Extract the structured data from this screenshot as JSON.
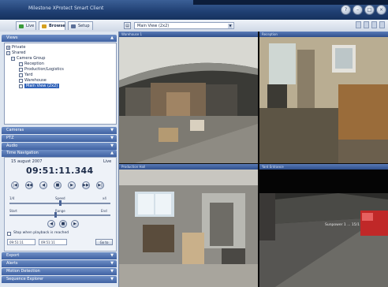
{
  "window": {
    "title": "Milestone XProtect Smart Client"
  },
  "tabs": [
    {
      "label": "Live",
      "color": "#3a9a3a"
    },
    {
      "label": "Browse",
      "color": "#d4a020"
    },
    {
      "label": "Setup",
      "color": "#5a6f98"
    }
  ],
  "view_selector": {
    "value": "Main View (2x2)"
  },
  "sections": {
    "views": "Views",
    "cameras": "Cameras",
    "ptz": "PTZ",
    "audio": "Audio",
    "time": "Time Navigation",
    "export": "Export",
    "alerts": "Alerts",
    "bottom1": "Motion Detection",
    "bottom2": "Sequence Explorer"
  },
  "tree": [
    {
      "label": "Private",
      "expander": "+"
    },
    {
      "label": "Shared",
      "expander": "-"
    },
    {
      "label": "Camera Group",
      "expander": "-"
    },
    {
      "label": "Reception",
      "expander": ""
    },
    {
      "label": "Production/Logistics",
      "expander": ""
    },
    {
      "label": "Yard",
      "expander": ""
    },
    {
      "label": "Warehouse",
      "expander": ""
    },
    {
      "label": "Main View (2x2)",
      "expander": "",
      "selected": true
    }
  ],
  "time_nav": {
    "date": "15 august 2007",
    "live_label": "Live",
    "clock": "09:51:11.344",
    "controls": [
      "|◀",
      "◀◀",
      "◀",
      "■",
      "▶",
      "▶▶",
      "▶|"
    ],
    "speed_labels": [
      "1/4",
      "Speed",
      "x4"
    ],
    "speed_fraction": 0.5,
    "range_labels": [
      "Start",
      "Range",
      "End"
    ],
    "range_fraction": 0.45,
    "buttons2": [
      "◀",
      "■",
      "▶"
    ],
    "checkbox_label": "Stop when playback is reached",
    "from_time": "09:51:11",
    "to_time": "09:51:11",
    "go_button": "Go to"
  },
  "cameras": [
    {
      "name": "Warehouse 1",
      "scene": "warehouse"
    },
    {
      "name": "Reception",
      "scene": "office"
    },
    {
      "name": "Production Hall",
      "scene": "loading"
    },
    {
      "name": "Yard Entrance",
      "scene": "yard"
    }
  ],
  "overlay_text": "Sunpower 1 ... 15/1",
  "toolbar_icons": [
    "refresh-icon",
    "layout-icon",
    "fullscreen-icon",
    "settings-icon"
  ]
}
